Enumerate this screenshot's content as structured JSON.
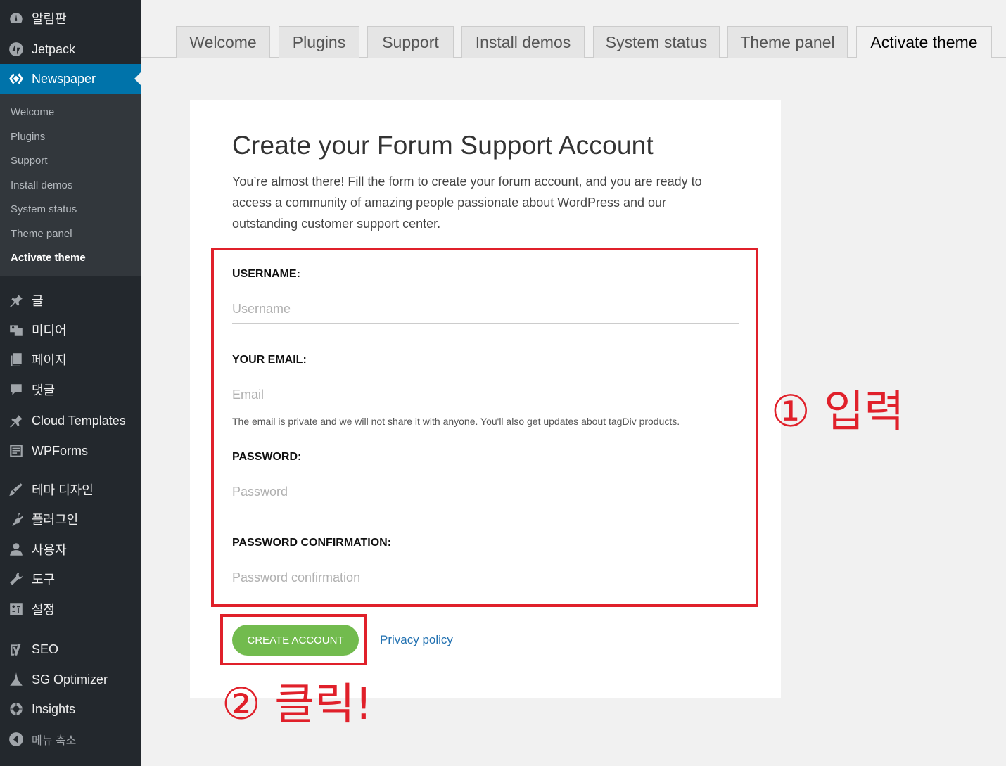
{
  "sidebar": {
    "top_items": [
      {
        "label": "알림판",
        "icon": "dashboard-icon"
      },
      {
        "label": "Jetpack",
        "icon": "jetpack-icon"
      },
      {
        "label": "Newspaper",
        "icon": "newspaper-icon"
      }
    ],
    "submenu": [
      "Welcome",
      "Plugins",
      "Support",
      "Install demos",
      "System status",
      "Theme panel",
      "Activate theme"
    ],
    "items": [
      {
        "label": "글",
        "icon": "pin-icon"
      },
      {
        "label": "미디어",
        "icon": "media-icon"
      },
      {
        "label": "페이지",
        "icon": "pages-icon"
      },
      {
        "label": "댓글",
        "icon": "comments-icon"
      },
      {
        "label": "Cloud Templates",
        "icon": "pin-icon"
      },
      {
        "label": "WPForms",
        "icon": "forms-icon"
      },
      {
        "label": "테마 디자인",
        "icon": "appearance-icon"
      },
      {
        "label": "플러그인",
        "icon": "plugins-icon"
      },
      {
        "label": "사용자",
        "icon": "users-icon"
      },
      {
        "label": "도구",
        "icon": "tools-icon"
      },
      {
        "label": "설정",
        "icon": "settings-icon"
      },
      {
        "label": "SEO",
        "icon": "yoast-icon"
      },
      {
        "label": "SG Optimizer",
        "icon": "sg-optimizer-icon"
      },
      {
        "label": "Insights",
        "icon": "insights-icon"
      },
      {
        "label": "메뉴 축소",
        "icon": "collapse-icon"
      }
    ]
  },
  "tabs": [
    "Welcome",
    "Plugins",
    "Support",
    "Install demos",
    "System status",
    "Theme panel",
    "Activate theme"
  ],
  "form": {
    "title": "Create your Forum Support Account",
    "description": "You’re almost there! Fill the form to create your forum account, and you are ready to access a community of amazing people passionate about WordPress and our outstanding customer support center.",
    "username_label": "USERNAME:",
    "username_placeholder": "Username",
    "email_label": "YOUR EMAIL:",
    "email_placeholder": "Email",
    "email_note": "The email is private and we will not share it with anyone. You'll also get updates about tagDiv products.",
    "password_label": "PASSWORD:",
    "password_placeholder": "Password",
    "confirm_label": "PASSWORD CONFIRMATION:",
    "confirm_placeholder": "Password confirmation",
    "create_button": "CREATE ACCOUNT",
    "privacy_link": "Privacy policy"
  },
  "annotations": {
    "step1": "① 입력",
    "step2": "② 클릭!",
    "color": "#e0202a"
  }
}
